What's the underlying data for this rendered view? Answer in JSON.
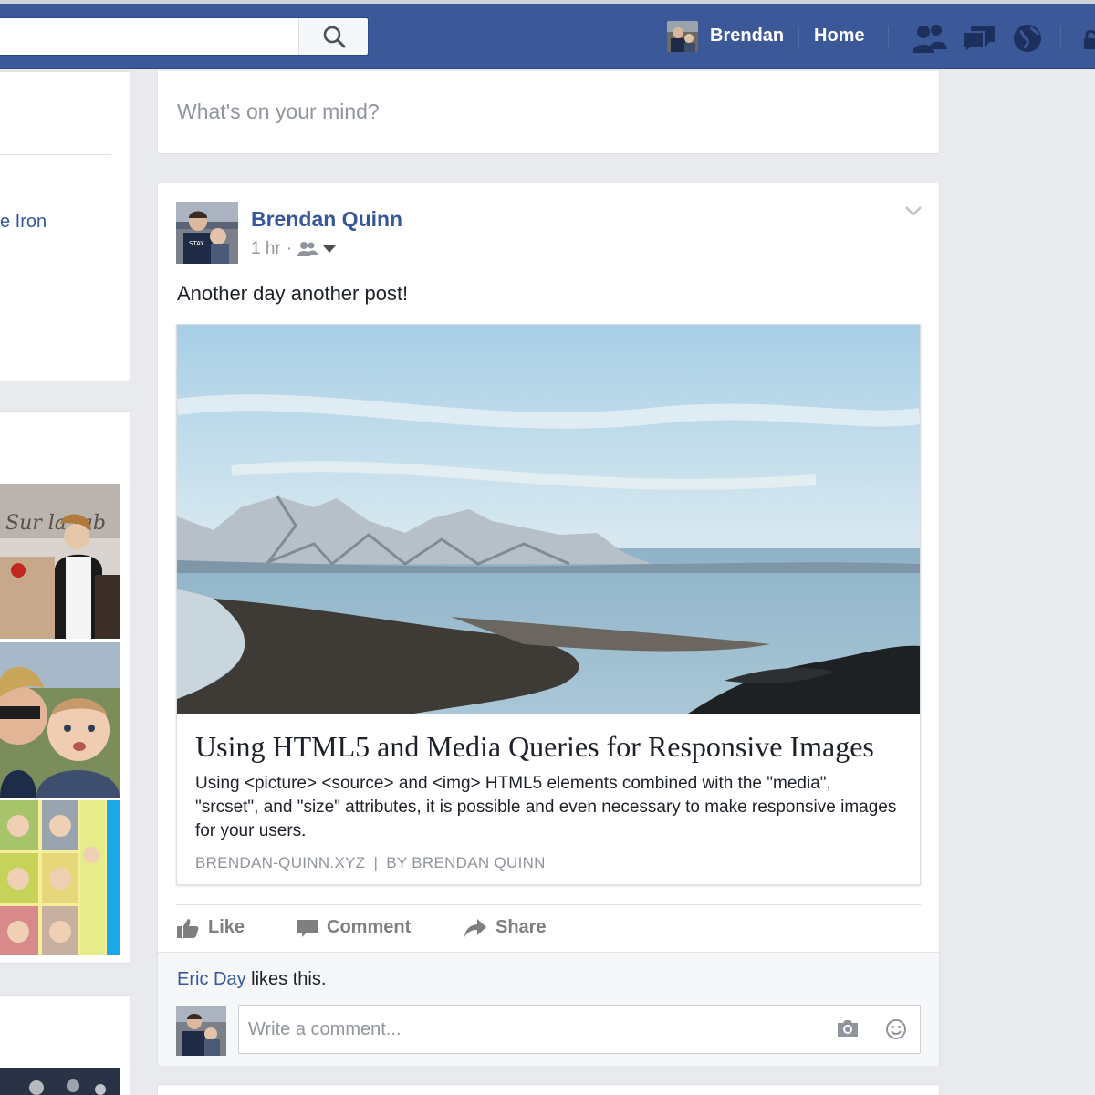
{
  "topbar": {
    "search": {
      "value": "",
      "placeholder": ""
    },
    "user_name": "Brendan",
    "home_label": "Home"
  },
  "left_column": {
    "link_text": "e Iron"
  },
  "composer": {
    "placeholder": "What's on your mind?"
  },
  "post": {
    "author": "Brendan Quinn",
    "time": "1 hr",
    "separator": "·",
    "text": "Another day another post!",
    "link_card": {
      "title": "Using HTML5 and Media Queries for Responsive Images",
      "description": "Using <picture> <source> and <img> HTML5 elements combined with the \"media\", \"srcset\", and \"size\" attributes, it is possible and even necessary to make responsive images for your users.",
      "domain": "BRENDAN-QUINN.XYZ",
      "domain_separator": "|",
      "byline": "BY BRENDAN QUINN"
    },
    "actions": {
      "like": "Like",
      "comment": "Comment",
      "share": "Share"
    },
    "likes": {
      "liker": "Eric Day",
      "suffix": " likes this."
    },
    "comment_placeholder": "Write a comment..."
  },
  "colors": {
    "brand": "#3b5998",
    "link": "#365899",
    "muted": "#90949c",
    "background": "#e9eaed"
  }
}
